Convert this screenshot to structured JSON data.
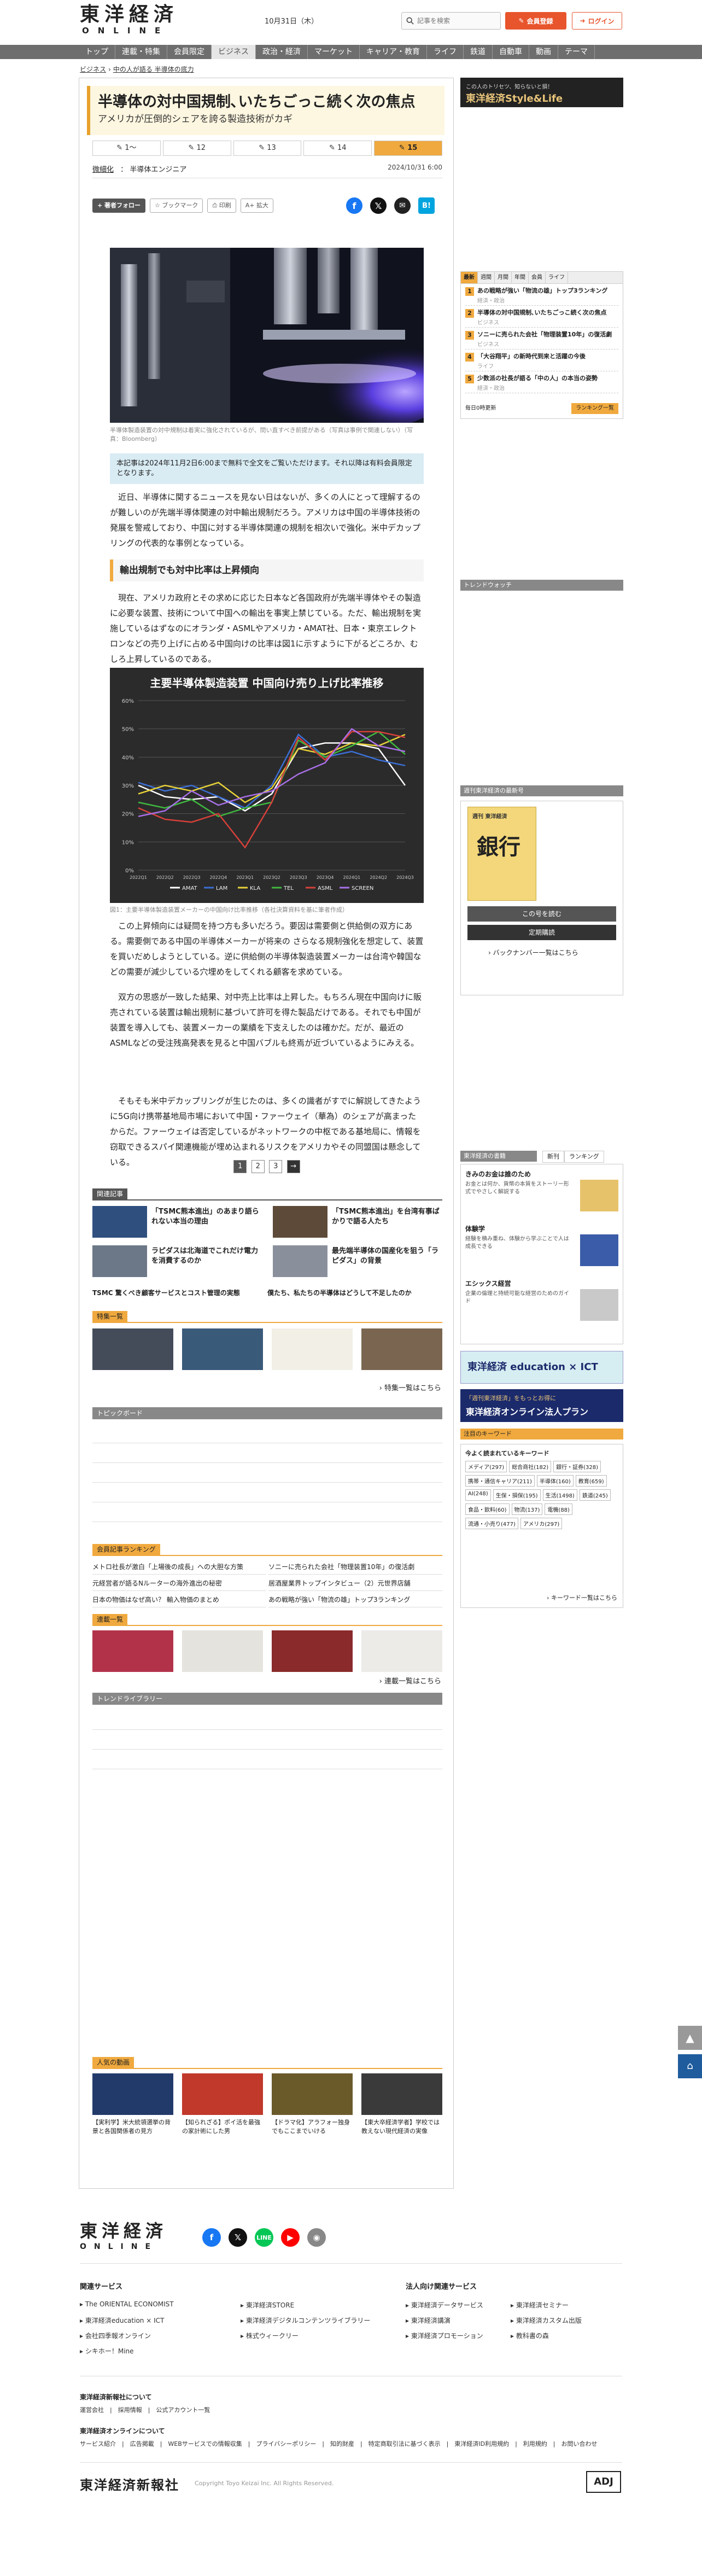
{
  "header": {
    "logo_top": "東洋経済",
    "logo_bottom": "ONLINE",
    "date": "10月31日（木）",
    "search_placeholder": "記事を検索",
    "member_label": "会員登録",
    "login_label": "ログイン"
  },
  "nav": [
    "トップ",
    "連載・特集",
    "会員限定",
    "ビジネス",
    "政治・経済",
    "マーケット",
    "キャリア・教育",
    "ライフ",
    "鉄道",
    "自動車",
    "動画",
    "テーマ"
  ],
  "breadcrumb": [
    "ビジネス",
    "中の人が語る 半導体の底力"
  ],
  "article": {
    "title": "半導体の対中国規制､いたちごっこ続く次の焦点",
    "subtitle": "アメリカが圧倒的シェアを誇る製造技術がカギ",
    "series_tabs": [
      "1〜",
      "12",
      "13",
      "14",
      "15"
    ],
    "author_label": "微細化",
    "author_name": "半導体エンジニア",
    "date": "2024/10/31 6:00",
    "tools": {
      "follow": "著者フォロー",
      "bookmark": "ブックマーク",
      "print": "印刷",
      "font": "A+ 拡大"
    },
    "image_caption": "半導体製造装置の対中規制は着実に強化されているが、問い直すべき前提がある（写真は事例で関連しない）（写真：Bloomberg）",
    "notice": "本記事は2024年11月2日6:00まで無料で全文をご覧いただけます。それ以降は有料会員限定となります。",
    "p1": "近日、半導体に関するニュースを見ない日はないが、多くの人にとって理解するのが難しいのが先端半導体関連の対中輸出規制だろう。アメリカは中国の半導体技術の発展を警戒しており、中国に対する半導体関連の規制を相次いで強化。米中デカップリングの代表的な事例となっている。",
    "h2": "輸出規制でも対中比率は上昇傾向",
    "p2": "現在、アメリカ政府とその求めに応じた日本など各国政府が先端半導体やその製造に必要な装置、技術について中国への輸出を事実上禁じている。ただ、輸出規制を実施しているはずなのにオランダ・ASMLやアメリカ・AMAT社、日本・東京エレクトロンなどの売り上げに占める中国向けの比率は図1に示すように下がるどころか、むしろ上昇しているのである。",
    "chart_caption": "図1：主要半導体製造装置メーカーの中国向け比率推移（各社決算資料を基に筆者作成）",
    "p3": "この上昇傾向には疑問を持つ方も多いだろう。要因は需要側と供給側の双方にある。需要側である中国の半導体メーカーが将来の さらなる規制強化を想定して、装置を買いだめしようとしている。逆に供給側の半導体製造装置メーカーは台湾や韓国などの需要が減少している穴埋めをしてくれる顧客を求めている。",
    "p4": "双方の思惑が一致した結果、対中売上比率は上昇した。もちろん現在中国向けに販売されている装置は輸出規制に基づいて許可を得た製品だけである。それでも中国が装置を導入しても、装置メーカーの業績を下支えしたのは確かだ。だが、最近のASMLなどの受注残高発表を見ると中国バブルも終焉が近づいているようにみえる。",
    "p5": "そもそも米中デカップリングが生じたのは、多くの識者がすでに解説してきたように5G向け携帯基地局市場において中国・ファーウェイ（華為）のシェアが高まったからだ。ファーウェイは否定しているがネットワークの中枢である基地局に、情報を窃取できるスパイ関連機能が埋め込まれるリスクをアメリカやその同盟国は懸念している。",
    "pager": [
      "1",
      "2",
      "3",
      "→"
    ]
  },
  "chart_data": {
    "type": "line",
    "title": "主要半導体製造装置 中国向け売り上げ比率推移",
    "x": [
      "2022Q1",
      "2022Q2",
      "2022Q3",
      "2022Q4",
      "2023Q1",
      "2023Q2",
      "2023Q3",
      "2023Q4",
      "2024Q1",
      "2024Q2",
      "2024Q3"
    ],
    "ylim": [
      0,
      60
    ],
    "yticks": [
      "0%",
      "10%",
      "20%",
      "30%",
      "40%",
      "50%",
      "60%"
    ],
    "series": [
      {
        "name": "AMAT",
        "color": "#ffffff",
        "values": [
          30,
          26,
          25,
          26,
          21,
          27,
          43,
          45,
          45,
          43,
          30
        ]
      },
      {
        "name": "LAM",
        "color": "#3b6fd6",
        "values": [
          31,
          28,
          30,
          26,
          22,
          30,
          48,
          40,
          42,
          39,
          37
        ]
      },
      {
        "name": "KLA",
        "color": "#e8d23a",
        "values": [
          27,
          30,
          28,
          31,
          24,
          29,
          43,
          41,
          45,
          44,
          48
        ]
      },
      {
        "name": "TEL",
        "color": "#3fb83f",
        "values": [
          24,
          22,
          25,
          19,
          22,
          24,
          46,
          40,
          44,
          49,
          41
        ]
      },
      {
        "name": "ASML",
        "color": "#d6403a",
        "values": [
          22,
          18,
          17,
          20,
          8,
          24,
          47,
          39,
          49,
          49,
          47
        ]
      },
      {
        "name": "SCREEN",
        "color": "#a970e8",
        "values": [
          19,
          21,
          28,
          23,
          26,
          28,
          34,
          38,
          50,
          44,
          42
        ]
      }
    ]
  },
  "related": {
    "label": "関連記事",
    "items": [
      "「TSMC熊本進出」のあまり語られない本当の理由",
      "「TSMC熊本進出」を台湾有事ばかりで語る人たち",
      "ラピダスは北海道でこれだけ電力を消費するのか",
      "最先端半導体の国産化を狙う「ラピダス」の背景"
    ],
    "more": [
      "TSMC 驚くべき顧客サービスとコスト管理の実態",
      "僕たち、私たちの半導体はどうして不足したのか"
    ]
  },
  "tokushu": {
    "label": "特集一覧",
    "more": "特集一覧はこちら"
  },
  "topic_board": {
    "label": "トピックボード",
    "ad": "AD"
  },
  "paid_ranking": {
    "label": "会員記事ランキング",
    "items": [
      "メトロ社長が激白「上場後の成長」への大胆な方策",
      "ソニーに売られた会社「物理装置10年」の復活劇",
      "元経営者が語るNルーターの海外進出の秘密",
      "居酒屋業界トップインタビュー（2）元世界店舗",
      "日本の物価はなぜ高い？ 輸入物価のまとめ",
      "あの戦略が強い「物流の雄」トップ3ランキング"
    ]
  },
  "serial": {
    "label": "連載一覧",
    "more": "連載一覧はこちら"
  },
  "trend_library": {
    "label": "トレンドライブラリー",
    "ad": "AD"
  },
  "popular": {
    "label": "人気の動画",
    "items": [
      "【実利学】米大統領選挙の背景と各国関係者の見方",
      "【知られざる】ポイ活を最強の家計術にした男",
      "【ドラマ化】アラフォー独身でもここまでいける",
      "【東大卒経済学者】学校では教えない現代経済の実像"
    ]
  },
  "sidebar": {
    "ad_style": {
      "line1": "この人のトリセツ、知らないと損！",
      "line2": "東洋経済Style&Life"
    },
    "ranking": {
      "tabs": [
        "最新",
        "週間",
        "月間",
        "年間",
        "会員",
        "ライフ"
      ],
      "items": [
        {
          "title": "あの戦略が強い「物流の雄」トップ3ランキング",
          "sub": "経済・政治"
        },
        {
          "title": "半導体の対中国規制､いたちごっこ続く次の焦点",
          "sub": "ビジネス"
        },
        {
          "title": "ソニーに売られた会社「物理装置10年」の復活劇",
          "sub": "ビジネス"
        },
        {
          "title": "「大谷翔平」の新時代到来と活躍の今後",
          "sub": "ライフ"
        },
        {
          "title": "少数派の社長が語る「中の人」の本当の姿勢",
          "sub": "経済・政治"
        }
      ],
      "foot_left": "毎日0時更新",
      "foot_right": "ランキング一覧"
    },
    "trend_watch": {
      "label": "トレンドウォッチ",
      "ad": "AD"
    },
    "magazine": {
      "label": "週刊東洋経済の最新号",
      "cover_title": "週刊 東洋経済",
      "cover_big": "銀行",
      "buy": "この号を読む",
      "subscribe": "定期購読",
      "backnumber": "バックナンバー一覧はこちら"
    },
    "popular": {
      "label": "東洋経済の書籍",
      "tabs": [
        "新刊",
        "ランキング"
      ],
      "items": [
        {
          "title": "きみのお金は誰のため",
          "desc": "お金とは何か、貨幣の本質をストーリー形式でやさしく解説する"
        },
        {
          "title": "体験学",
          "desc": "経験を積み重ね、体験から学ぶことで人は成長できる"
        },
        {
          "title": "エシックス経営",
          "desc": "企業の倫理と持続可能な経営のためのガイド"
        }
      ]
    },
    "ad_edu": "東洋経済 education × ICT",
    "ad_corp": {
      "line1": "「週刊東洋経済」をもっとお得に",
      "line2": "東洋経済オンライン法人プラン"
    },
    "keywords": {
      "label": "注目のキーワード",
      "heading": "今よく読まれているキーワード",
      "tags": [
        "メディア(297)",
        "総合商社(182)",
        "銀行・証券(328)",
        "携帯・通信キャリア(211)",
        "半導体(160)",
        "教育(659)",
        "AI(248)",
        "生保・損保(195)",
        "生活(1498)",
        "鉄道(245)",
        "食品・飲料(60)",
        "物流(137)",
        "電機(88)",
        "流通・小売り(477)",
        "アメリカ(297)"
      ],
      "more": "キーワード一覧はこちら"
    }
  },
  "footer": {
    "logo_top": "東洋経済",
    "logo_bottom": "ONLINE",
    "service_heading": "関連サービス",
    "services": [
      "The ORIENTAL ECONOMIST",
      "東洋経済STORE",
      "東洋経済education × ICT",
      "東洋経済デジタルコンテンツライブラリー",
      "会社四季報オンライン",
      "株式ウィークリー",
      "シキホー！Mine"
    ],
    "corp_heading": "法人向け関連サービス",
    "corp_services": [
      "東洋経済データサービス",
      "東洋経済セミナー",
      "東洋経済講演",
      "東洋経済カスタム出版",
      "東洋経済プロモーション",
      "教科書の森"
    ],
    "publisher_heading": "東洋経済新報社について",
    "publisher_links": "運営会社　|　採用情報　|　公式アカウント一覧",
    "online_heading": "東洋経済オンラインについて",
    "online_links": "サービス紹介　|　広告掲載　|　WEBサービスでの情報収集　|　プライバシーポリシー　|　知的財産　|　特定商取引法に基づく表示　|　東洋経済ID利用規約　|　利用規約　|　お問い合わせ",
    "bottom_logo": "東洋経済新報社",
    "copyright": "Copyright Toyo Keizai Inc. All Rights Reserved.",
    "adj": "ADJ"
  }
}
